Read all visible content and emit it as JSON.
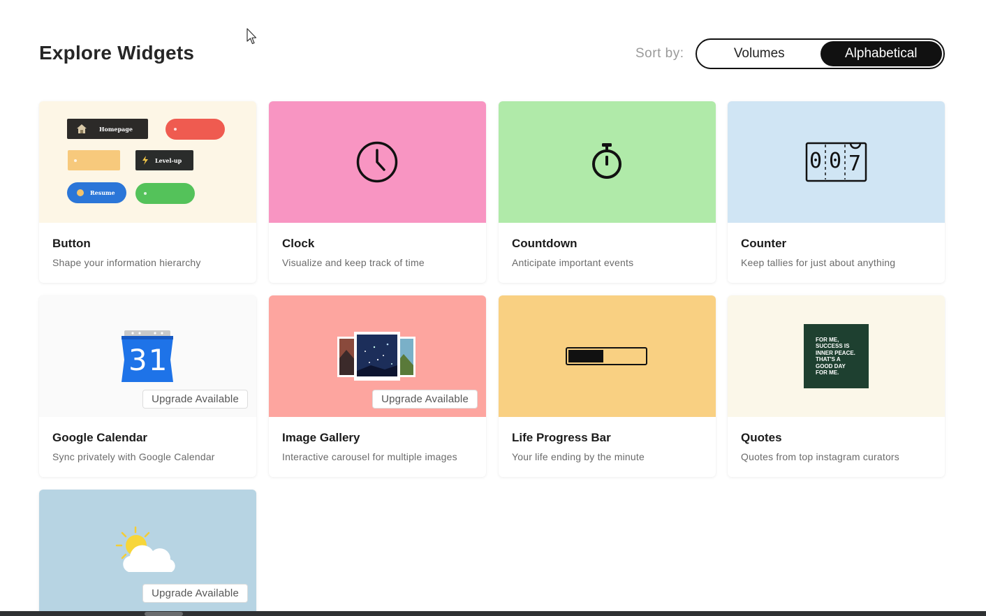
{
  "header": {
    "title": "Explore Widgets",
    "sort_label": "Sort by:",
    "sort_options": [
      "Volumes",
      "Alphabetical"
    ],
    "sort_selected": "Alphabetical"
  },
  "widgets": [
    {
      "title": "Button",
      "desc": "Shape your information hierarchy",
      "bg": "#fdf6e6",
      "upgrade": "",
      "preview": {
        "home": "Homepage",
        "level": "Level-up",
        "resume": "Resume"
      }
    },
    {
      "title": "Clock",
      "desc": "Visualize and keep track of time",
      "bg": "#f895c2",
      "upgrade": ""
    },
    {
      "title": "Countdown",
      "desc": "Anticipate important events",
      "bg": "#b0eaa9",
      "upgrade": ""
    },
    {
      "title": "Counter",
      "desc": "Keep tallies for just about anything",
      "bg": "#d0e5f4",
      "upgrade": "",
      "preview": {
        "digits": [
          "0",
          "0",
          "7"
        ]
      }
    },
    {
      "title": "Google Calendar",
      "desc": "Sync privately with Google Calendar",
      "bg": "#fafafa",
      "upgrade": "Upgrade Available",
      "preview": {
        "day": "31"
      }
    },
    {
      "title": "Image Gallery",
      "desc": "Interactive carousel for multiple images",
      "bg": "#fda59f",
      "upgrade": "Upgrade Available"
    },
    {
      "title": "Life Progress Bar",
      "desc": "Your life ending by the minute",
      "bg": "#f9d082",
      "upgrade": "",
      "preview": {
        "progress": 0.46
      }
    },
    {
      "title": "Quotes",
      "desc": "Quotes from top instagram curators",
      "bg": "#fbf7e9",
      "upgrade": "",
      "preview": {
        "quote": [
          "FOR ME,",
          "SUCCESS IS",
          "INNER PEACE.",
          "THAT'S A",
          "GOOD DAY",
          "FOR ME."
        ]
      }
    },
    {
      "title": "",
      "desc": "",
      "bg": "#b7d4e3",
      "upgrade": "Upgrade Available"
    }
  ]
}
